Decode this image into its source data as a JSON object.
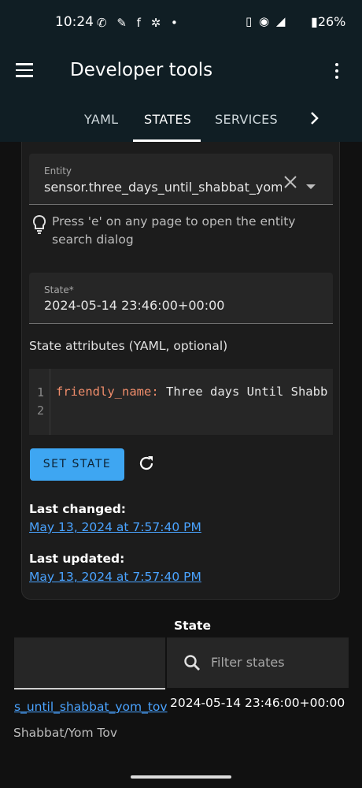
{
  "status_bar": {
    "time": "10:24",
    "notif_icons": "✆ ✎ f ✲ •",
    "right_icons": "▯ ◉ ◢",
    "battery": "26%"
  },
  "app_bar": {
    "title": "Developer tools",
    "tabs": [
      {
        "label": "YAML",
        "active": false
      },
      {
        "label": "STATES",
        "active": true
      },
      {
        "label": "SERVICES",
        "active": false
      }
    ],
    "next_chevron": "›"
  },
  "entity_field": {
    "label": "Entity",
    "value": "sensor.three_days_until_shabbat_yom_to"
  },
  "hint": "Press 'e' on any page to open the entity search dialog",
  "state_field": {
    "label": "State*",
    "value": "2024-05-14 23:46:00+00:00"
  },
  "attributes": {
    "label": "State attributes (YAML, optional)",
    "line_numbers": [
      "1",
      "2"
    ],
    "key": "friendly_name",
    "colon": ":",
    "value": " Three days Until Shabb"
  },
  "set_state_button": "SET STATE",
  "last_changed": {
    "label": "Last changed:",
    "value": "May 13, 2024 at 7:57:40 PM"
  },
  "last_updated": {
    "label": "Last updated:",
    "value": "May 13, 2024 at 7:57:40 PM"
  },
  "table": {
    "state_header": "State",
    "filter_placeholder": "Filter states",
    "row": {
      "entity": "s_until_shabbat_yom_tov",
      "state": "2024-05-14 23:46:00+00:00",
      "name": "Shabbat/Yom Tov"
    }
  },
  "colors": {
    "app_bar": "#101e24",
    "accent": "#3ea6f2",
    "link": "#4aa3ff",
    "yaml_key": "#f08d6b"
  }
}
